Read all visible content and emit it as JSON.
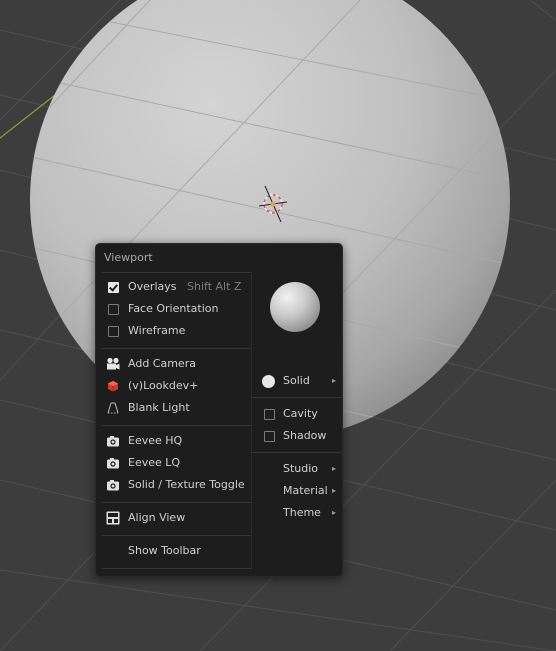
{
  "menu": {
    "title": "Viewport",
    "overlays": {
      "label": "Overlays",
      "checked": true,
      "shortcut": "Shift Alt Z"
    },
    "face_orientation": {
      "label": "Face Orientation",
      "checked": false
    },
    "wireframe": {
      "label": "Wireframe",
      "checked": false
    },
    "add_camera": {
      "label": "Add Camera",
      "icon": "camera-icon"
    },
    "lookdev": {
      "label": "(v)Lookdev+",
      "icon": "lookdev-cube-icon"
    },
    "blank_light": {
      "label": "Blank Light",
      "icon": "light-icon"
    },
    "eevee_hq": {
      "label": "Eevee HQ",
      "icon": "render-camera-icon"
    },
    "eevee_lq": {
      "label": "Eevee LQ",
      "icon": "render-camera-icon"
    },
    "solid_texture": {
      "label": "Solid / Texture Toggle",
      "icon": "render-camera-icon"
    },
    "align_view": {
      "label": "Align View",
      "icon": "align-view-icon"
    },
    "show_toolbar": {
      "label": "Show Toolbar"
    }
  },
  "shading": {
    "preview_icon": "matcap-sphere-icon",
    "solid": {
      "label": "Solid",
      "icon": "solid-circle-icon"
    },
    "cavity": {
      "label": "Cavity",
      "checked": false
    },
    "shadow": {
      "label": "Shadow",
      "checked": false
    },
    "studio": {
      "label": "Studio"
    },
    "material": {
      "label": "Material"
    },
    "theme": {
      "label": "Theme"
    },
    "submenu_arrow": "▸"
  },
  "colors": {
    "viewport_bg": "#3d3d3d",
    "menu_bg": "#1d1d1d",
    "sphere": "#c8c8c8",
    "y_axis": "#7ea83a"
  }
}
